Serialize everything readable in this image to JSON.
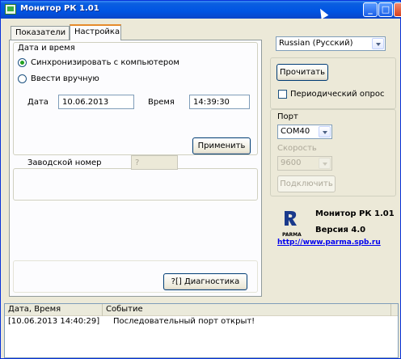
{
  "window": {
    "title": "Монитор РК 1.01"
  },
  "tabs": [
    {
      "label": "Показатели"
    },
    {
      "label": "Настройка"
    }
  ],
  "datetime_group": {
    "title": "Дата и время",
    "sync_label": "Синхронизировать с компьютером",
    "manual_label": "Ввести вручную",
    "date_label": "Дата",
    "date_value": "10.06.2013",
    "time_label": "Время",
    "time_value": "14:39:30",
    "apply_label": "Применить"
  },
  "serial_group": {
    "label": "Заводской номер",
    "value": "?"
  },
  "diagnostics_label": "?[] Диагностика",
  "right_panel": {
    "language_value": "Russian (Русский)",
    "read_label": "Прочитать",
    "periodic_label": "Периодический опрос",
    "port_label": "Порт",
    "port_value": "COM40",
    "speed_label": "Скорость",
    "speed_value": "9600",
    "connect_label": "Подключить"
  },
  "about": {
    "name": "Монитор РК 1.01",
    "version": "Версия 4.0",
    "brand": "PARMA",
    "url": "http://www.parma.spb.ru"
  },
  "log": {
    "columns": [
      "Дата, Время",
      "Событие"
    ],
    "rows": [
      {
        "time": "[10.06.2013 14:40:29]",
        "event": "Последовательный порт открыт!"
      }
    ]
  },
  "colors": {
    "titlebar": "#0054e3",
    "tab_highlight": "#e68b2c",
    "link": "#0000ee"
  }
}
